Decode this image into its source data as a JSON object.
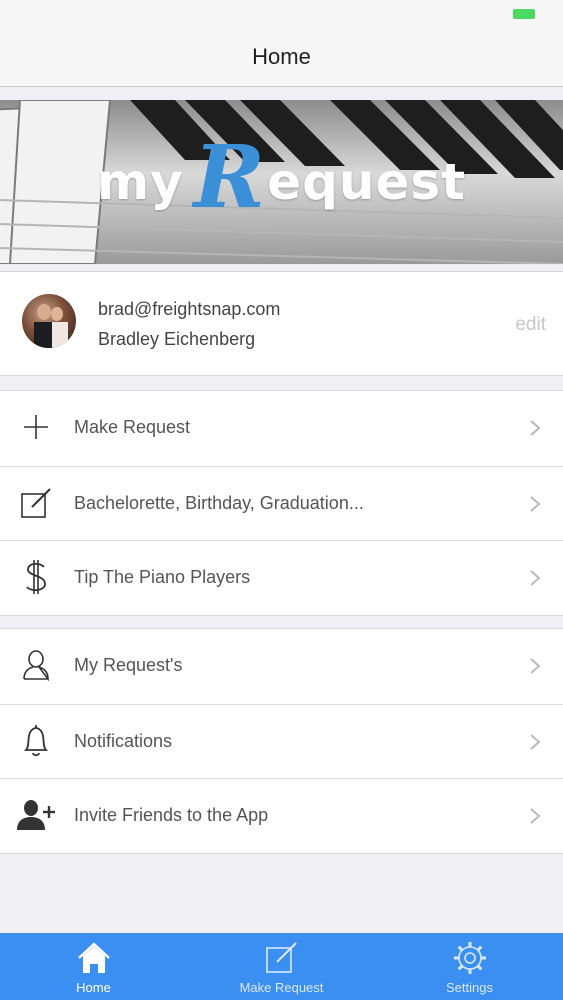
{
  "nav": {
    "title": "Home"
  },
  "banner": {
    "logo_my": "my",
    "logo_r": "R",
    "logo_rest": "equest"
  },
  "profile": {
    "email": "brad@freightsnap.com",
    "name": "Bradley Eichenberg",
    "edit_label": "edit"
  },
  "menu_group_1": [
    {
      "label": "Make Request",
      "icon": "plus-icon"
    },
    {
      "label": "Bachelorette, Birthday, Graduation...",
      "icon": "compose-icon"
    },
    {
      "label": "Tip The Piano Players",
      "icon": "dollar-icon"
    }
  ],
  "menu_group_2": [
    {
      "label": "My Request's",
      "icon": "person-icon"
    },
    {
      "label": "Notifications",
      "icon": "bell-icon"
    },
    {
      "label": "Invite Friends to the App",
      "icon": "add-user-icon"
    }
  ],
  "tabs": [
    {
      "label": "Home",
      "icon": "home-icon",
      "active": true
    },
    {
      "label": "Make Request",
      "icon": "compose-icon",
      "active": false
    },
    {
      "label": "Settings",
      "icon": "gear-icon",
      "active": false
    }
  ],
  "colors": {
    "accent": "#3b8ff0",
    "logo_r": "#3a8fd6",
    "battery": "#4cd964"
  }
}
